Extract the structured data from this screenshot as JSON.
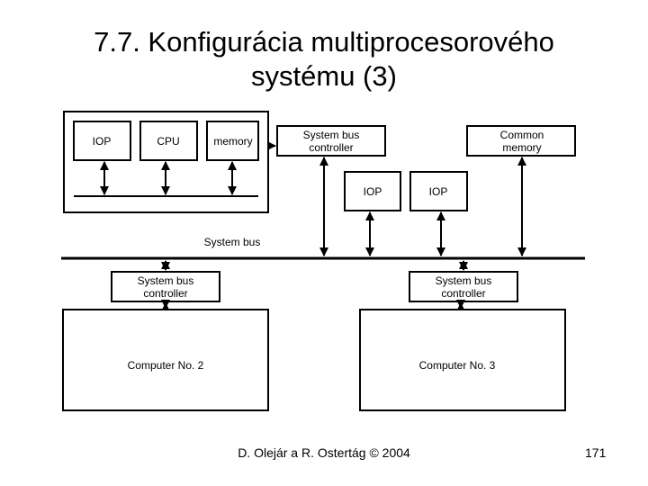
{
  "slide": {
    "title_line1": "7.7. Konfigurácia multiprocesorového",
    "title_line2": "systému (3)",
    "footer": "D. Olejár a R. Ostertág © 2004",
    "page_number": "171"
  },
  "diagram": {
    "computer1": {
      "iop": "IOP",
      "cpu": "CPU",
      "memory": "memory",
      "sbc_line1": "System bus",
      "sbc_line2": "controller",
      "iop2": "IOP",
      "iop3": "IOP",
      "common_memory_line1": "Common",
      "common_memory_line2": "memory"
    },
    "system_bus_label": "System bus",
    "computer2": {
      "sbc_line1": "System bus",
      "sbc_line2": "controller",
      "label": "Computer No. 2"
    },
    "computer3": {
      "sbc_line1": "System bus",
      "sbc_line2": "controller",
      "label": "Computer No. 3"
    }
  }
}
